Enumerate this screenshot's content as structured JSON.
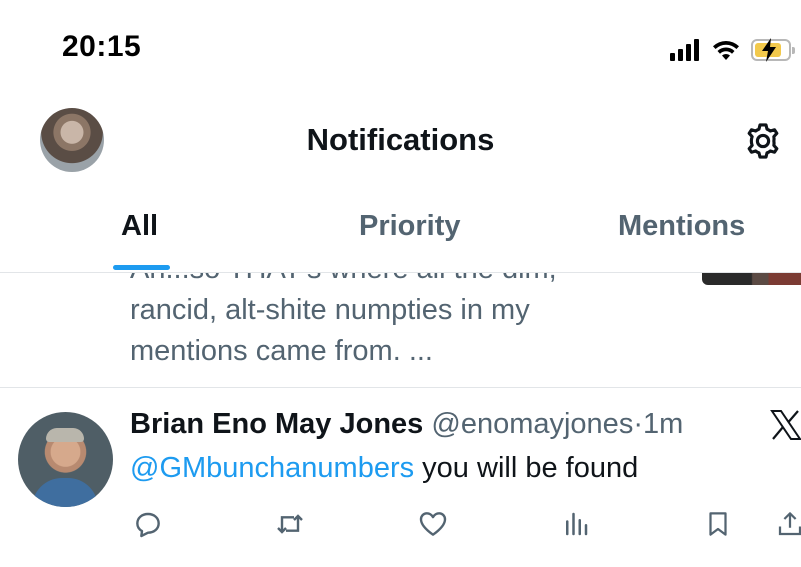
{
  "status_bar": {
    "time": "20:15"
  },
  "header": {
    "title": "Notifications"
  },
  "tabs": [
    {
      "label": "All",
      "active": true
    },
    {
      "label": "Priority",
      "active": false
    },
    {
      "label": "Mentions",
      "active": false
    }
  ],
  "previous_tweet": {
    "lines": [
      "Ah...so THAT's where all the dim,",
      "rancid, alt-shite numpties in my",
      "mentions came from. ..."
    ]
  },
  "tweet": {
    "display_name": "Brian Eno May Jones",
    "handle": "@enomayjones",
    "separator": "·",
    "time_ago": "1m",
    "mention": "@GMbunchanumbers",
    "text": " you will be found",
    "actions": [
      "reply-icon",
      "retweet-icon",
      "like-icon",
      "views-icon",
      "bookmark-icon",
      "share-icon"
    ]
  },
  "colors": {
    "accent": "#1d9bf0",
    "secondary_text": "#536471",
    "primary_text": "#0f1419",
    "divider": "#e2e5e8",
    "battery": "#f2c94c"
  }
}
